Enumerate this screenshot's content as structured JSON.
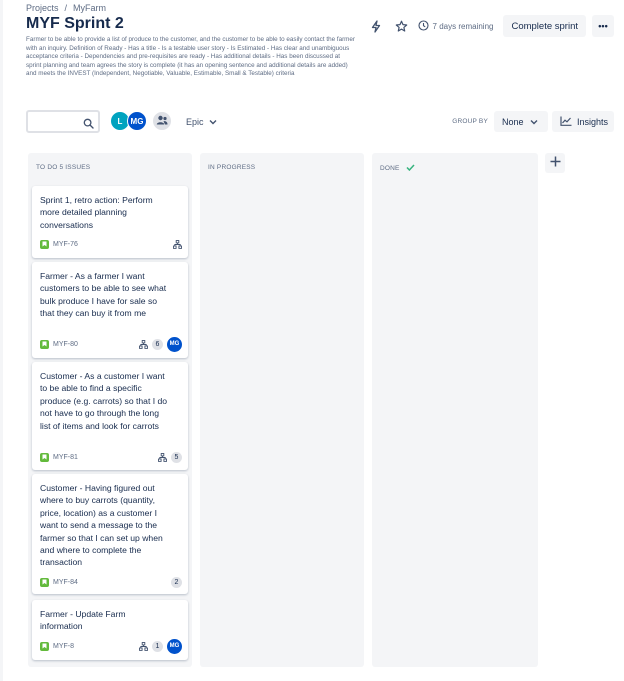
{
  "breadcrumb": {
    "items": [
      "Projects",
      "MyFarm"
    ],
    "separator": "/"
  },
  "page": {
    "title": "MYF Sprint 2",
    "sprint_goal": "Farmer to be able to provide a list of produce to the customer, and the customer to be able to easily contact the farmer with an inquiry. Definition of Ready - Has a title - Is a testable user story - Is Estimated - Has clear and unambiguous acceptance criteria - Dependencies and pre-requisites are ready - Has additional details - Has been discussed at sprint planning and team agrees the story is complete (it has an opening sentence and additional details are added) and meets the INVEST (Independent, Negotiable, Valuable, Estimable, Small & Testable) criteria"
  },
  "header": {
    "days_remaining": "7 days remaining",
    "complete_sprint_label": "Complete sprint",
    "more_label": "•••"
  },
  "toolbar": {
    "search_placeholder": "",
    "avatars": [
      {
        "initials": "L",
        "color": "#00a3bf"
      },
      {
        "initials": "MG",
        "color": "#0052cc"
      }
    ],
    "epic_label": "Epic",
    "group_by_label": "GROUP BY",
    "group_by_value": "None",
    "insights_label": "Insights"
  },
  "columns": [
    {
      "title": "TO DO 5 ISSUES"
    },
    {
      "title": "IN PROGRESS"
    },
    {
      "title": "DONE"
    }
  ],
  "cards": [
    {
      "summary": "Sprint 1, retro action: Perform more detailed planning conversations",
      "key": "MYF-76",
      "subtasks": true,
      "count": "",
      "assignee": ""
    },
    {
      "summary": "Farmer - As a farmer I want customers to be able to see what bulk produce I have for sale so that they can buy it from me",
      "key": "MYF-80",
      "subtasks": true,
      "count": "6",
      "assignee": "MG"
    },
    {
      "summary": "Customer - As a customer I want to be able to find a specific produce (e.g. carrots) so that I do not have to go through the long list of items and look for carrots",
      "key": "MYF-81",
      "subtasks": true,
      "count": "5",
      "assignee": ""
    },
    {
      "summary": "Customer - Having figured out where to buy carrots (quantity, price, location) as a customer I want to send a message to the farmer so that I can set up when and where to complete the transaction",
      "key": "MYF-84",
      "subtasks": false,
      "count": "2",
      "assignee": ""
    },
    {
      "summary": "Farmer - Update Farm information",
      "key": "MYF-8",
      "subtasks": true,
      "count": "1",
      "assignee": "MG"
    }
  ],
  "colors": {
    "story": "#63ba3c",
    "done_check": "#36b37e",
    "avatar_blue": "#0052cc",
    "avatar_teal": "#00a3bf"
  }
}
